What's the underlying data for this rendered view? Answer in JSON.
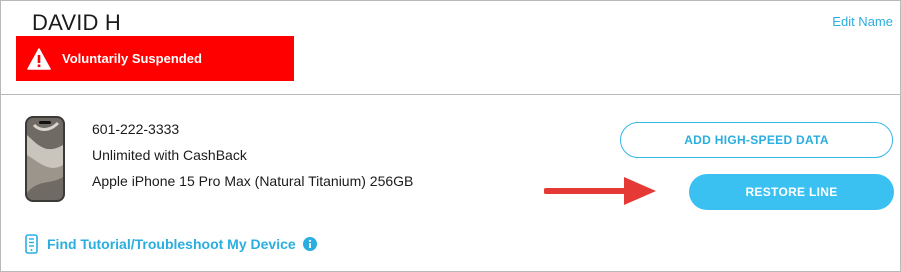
{
  "account": {
    "name": "DAVID H",
    "edit_label": "Edit Name",
    "status": {
      "text": "Voluntarily Suspended",
      "icon": "warning-triangle-icon",
      "color": "#ff0000"
    }
  },
  "line": {
    "phone_number": "601-222-3333",
    "plan": "Unlimited with CashBack",
    "device": "Apple iPhone 15 Pro Max (Natural Titanium) 256GB",
    "device_icon": "phone-image",
    "actions": {
      "add_data_label": "ADD HIGH-SPEED DATA",
      "restore_label": "RESTORE LINE"
    },
    "tutorial": {
      "label": "Find Tutorial/Troubleshoot My Device",
      "icon": "device-icon",
      "info_icon": "info-icon"
    }
  },
  "colors": {
    "accent": "#2aaee0",
    "button_fill": "#3ac1f1",
    "alert": "#ff0000",
    "arrow": "#e53935"
  }
}
